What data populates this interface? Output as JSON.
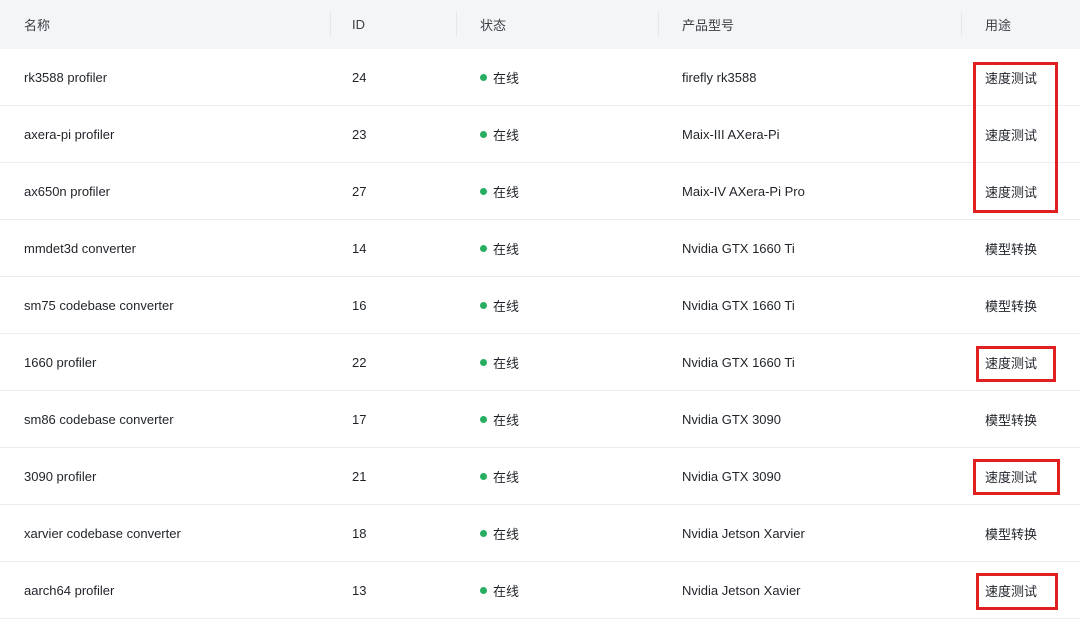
{
  "headers": {
    "name": "名称",
    "id": "ID",
    "status": "状态",
    "model": "产品型号",
    "usage": "用途"
  },
  "rows": [
    {
      "name": "rk3588 profiler",
      "id": "24",
      "status": "在线",
      "model": "firefly rk3588",
      "usage": "速度测试"
    },
    {
      "name": "axera-pi profiler",
      "id": "23",
      "status": "在线",
      "model": "Maix-III AXera-Pi",
      "usage": "速度测试"
    },
    {
      "name": "ax650n profiler",
      "id": "27",
      "status": "在线",
      "model": "Maix-IV AXera-Pi Pro",
      "usage": "速度测试"
    },
    {
      "name": "mmdet3d converter",
      "id": "14",
      "status": "在线",
      "model": "Nvidia GTX 1660 Ti",
      "usage": "模型转换"
    },
    {
      "name": "sm75 codebase converter",
      "id": "16",
      "status": "在线",
      "model": "Nvidia GTX 1660 Ti",
      "usage": "模型转换"
    },
    {
      "name": "1660 profiler",
      "id": "22",
      "status": "在线",
      "model": "Nvidia GTX 1660 Ti",
      "usage": "速度测试"
    },
    {
      "name": "sm86 codebase converter",
      "id": "17",
      "status": "在线",
      "model": "Nvidia GTX 3090",
      "usage": "模型转换"
    },
    {
      "name": "3090 profiler",
      "id": "21",
      "status": "在线",
      "model": "Nvidia GTX 3090",
      "usage": "速度测试"
    },
    {
      "name": "xarvier codebase converter",
      "id": "18",
      "status": "在线",
      "model": "Nvidia Jetson Xarvier",
      "usage": "模型转换"
    },
    {
      "name": "aarch64 profiler",
      "id": "13",
      "status": "在线",
      "model": "Nvidia Jetson Xavier",
      "usage": "速度测试"
    }
  ],
  "colors": {
    "online_dot": "#27ae60",
    "highlight_box": "#e02020",
    "header_bg": "#f4f5f7"
  }
}
